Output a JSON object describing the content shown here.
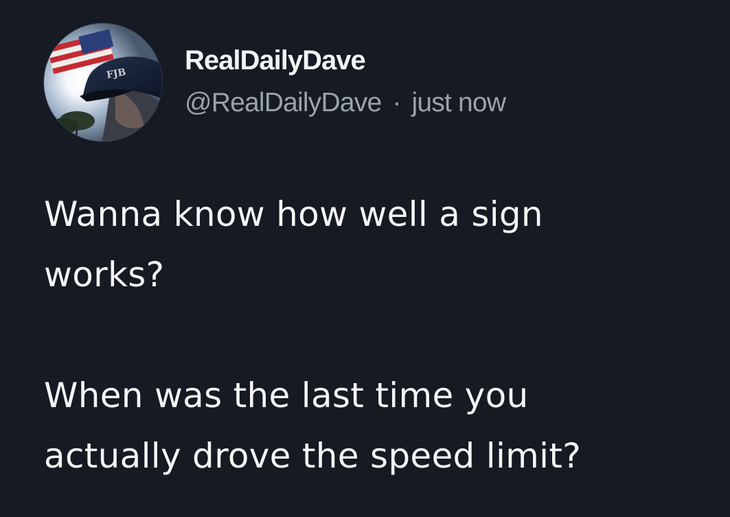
{
  "tweet": {
    "author": {
      "display_name": "RealDailyDave",
      "handle": "@RealDailyDave",
      "avatar_hat_text": "FJB"
    },
    "separator": "·",
    "timestamp": "just now",
    "text_lines": [
      "Wanna know how well a sign",
      "works?",
      "When was the last time you",
      "actually drove the speed limit?"
    ]
  },
  "colors": {
    "background": "#151a23",
    "name": "#f2f3f4",
    "meta": "#9aa3ad",
    "body": "#f5f5f5"
  }
}
